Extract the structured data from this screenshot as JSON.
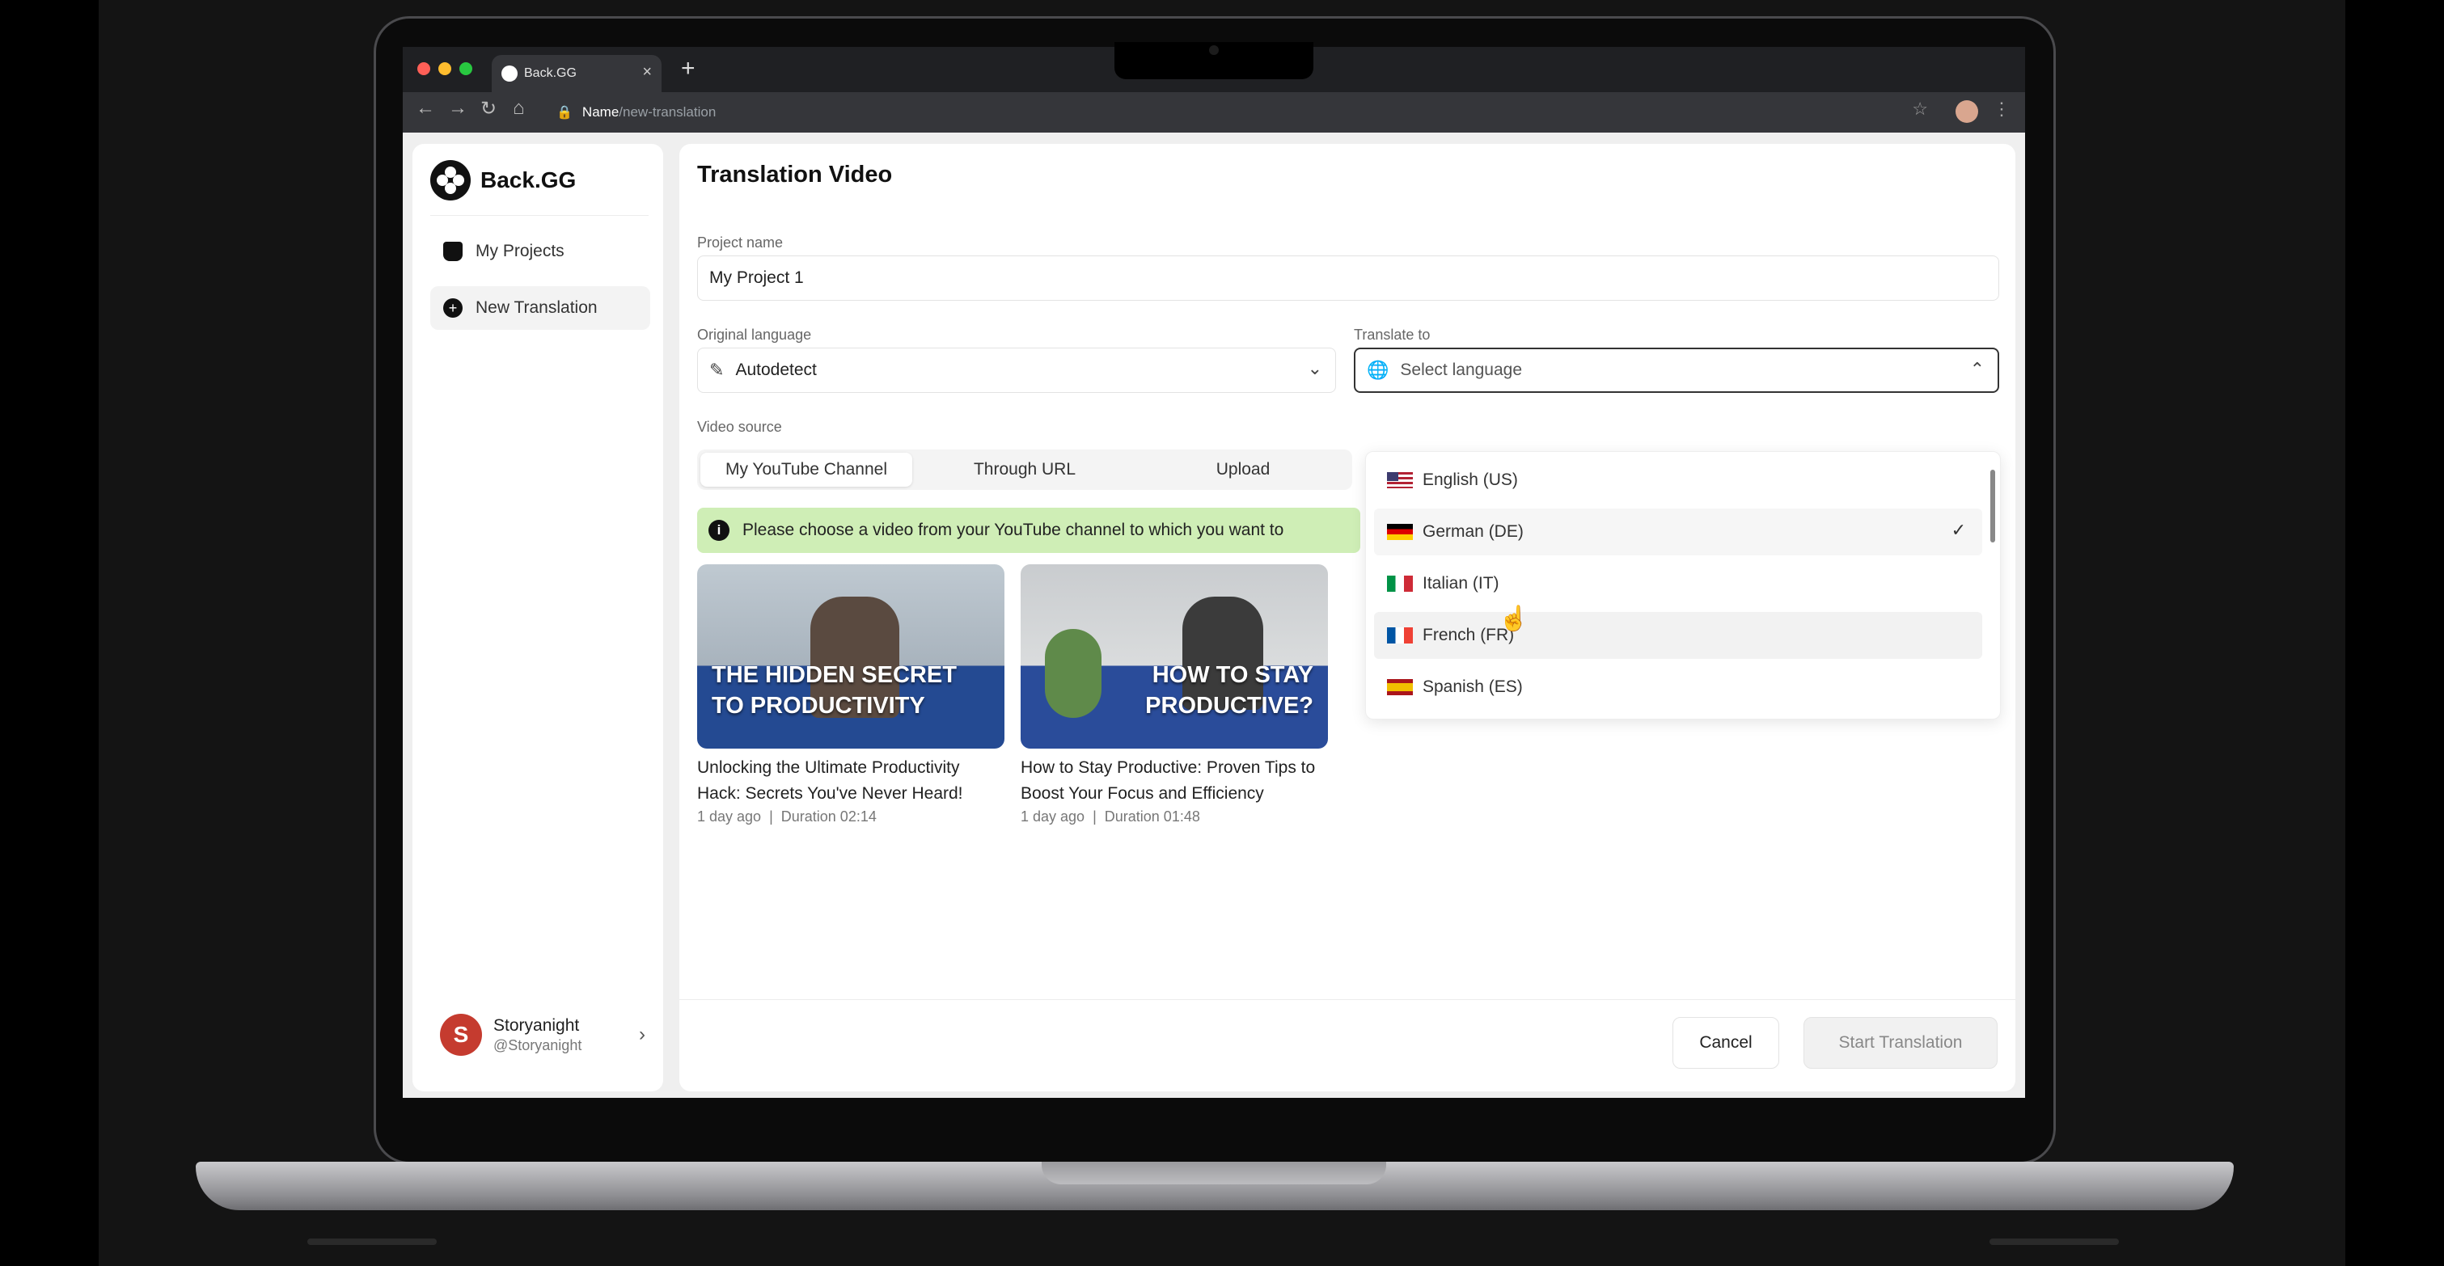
{
  "browser": {
    "tab_title": "Back.GG",
    "url_host": "Name",
    "url_path": "/new-translation"
  },
  "sidebar": {
    "brand": "Back.GG",
    "items": [
      {
        "label": "My Projects",
        "icon": "folder-icon"
      },
      {
        "label": "New Translation",
        "icon": "plus-circle-icon",
        "active": true
      }
    ],
    "user": {
      "initial": "S",
      "name": "Storyanight",
      "handle": "@Storyanight"
    }
  },
  "main": {
    "title": "Translation Video",
    "project_name_label": "Project name",
    "project_name_value": "My Project 1",
    "original_language_label": "Original language",
    "original_language_value": "Autodetect",
    "translate_to_label": "Translate to",
    "translate_to_placeholder": "Select language",
    "video_source_label": "Video source",
    "video_source_tabs": [
      {
        "label": "My YouTube Channel",
        "active": true
      },
      {
        "label": "Through URL"
      },
      {
        "label": "Upload"
      }
    ],
    "banner_text": "Please choose a video from your YouTube channel to which you want to",
    "videos": [
      {
        "thumb_text_line1": "THE HIDDEN SECRET",
        "thumb_text_line2": "TO PRODUCTIVITY",
        "title": "Unlocking the Ultimate Productivity Hack: Secrets You've Never Heard!",
        "age": "1 day ago",
        "duration": "Duration 02:14"
      },
      {
        "thumb_text_line1": "HOW TO STAY",
        "thumb_text_line2": "PRODUCTIVE?",
        "title": "How to Stay Productive: Proven Tips to Boost Your Focus and Efficiency",
        "age": "1 day ago",
        "duration": "Duration 01:48"
      }
    ],
    "languages": [
      {
        "label": "English (US)",
        "flag": "us"
      },
      {
        "label": "German (DE)",
        "flag": "de",
        "selected": true
      },
      {
        "label": "Italian (IT)",
        "flag": "it"
      },
      {
        "label": "French (FR)",
        "flag": "fr",
        "hover": true
      },
      {
        "label": "Spanish (ES)",
        "flag": "es"
      }
    ],
    "cancel_label": "Cancel",
    "start_label": "Start Translation"
  }
}
